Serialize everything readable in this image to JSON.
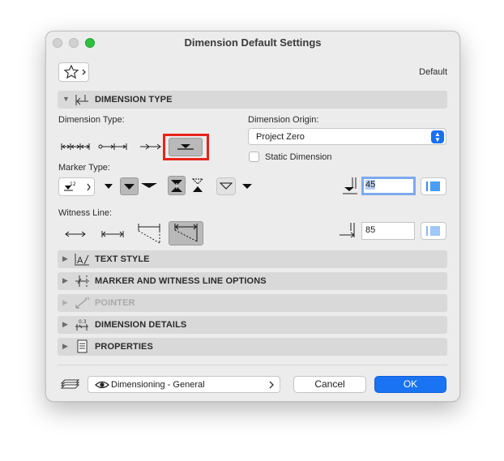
{
  "window": {
    "title": "Dimension Default Settings"
  },
  "favorites": {
    "preset_name": "Default"
  },
  "sections": {
    "dimension_type": "DIMENSION TYPE",
    "text_style": "TEXT STYLE",
    "marker_witness": "MARKER AND WITNESS LINE OPTIONS",
    "pointer": "POINTER",
    "dimension_details": "DIMENSION DETAILS",
    "properties": "PROPERTIES"
  },
  "dimension_type": {
    "label": "Dimension Type:",
    "origin_label": "Dimension Origin:",
    "origin_value": "Project Zero",
    "static_label": "Static Dimension",
    "static_checked": false
  },
  "marker_type": {
    "label": "Marker Type:",
    "selector_value": "12",
    "angle_value": "45"
  },
  "witness_line": {
    "label": "Witness Line:",
    "length_value": "85"
  },
  "footer": {
    "layer_value": "Dimensioning - General",
    "cancel_label": "Cancel",
    "ok_label": "OK"
  },
  "colors": {
    "accent": "#1a73f2",
    "highlight": "#e8231a"
  }
}
